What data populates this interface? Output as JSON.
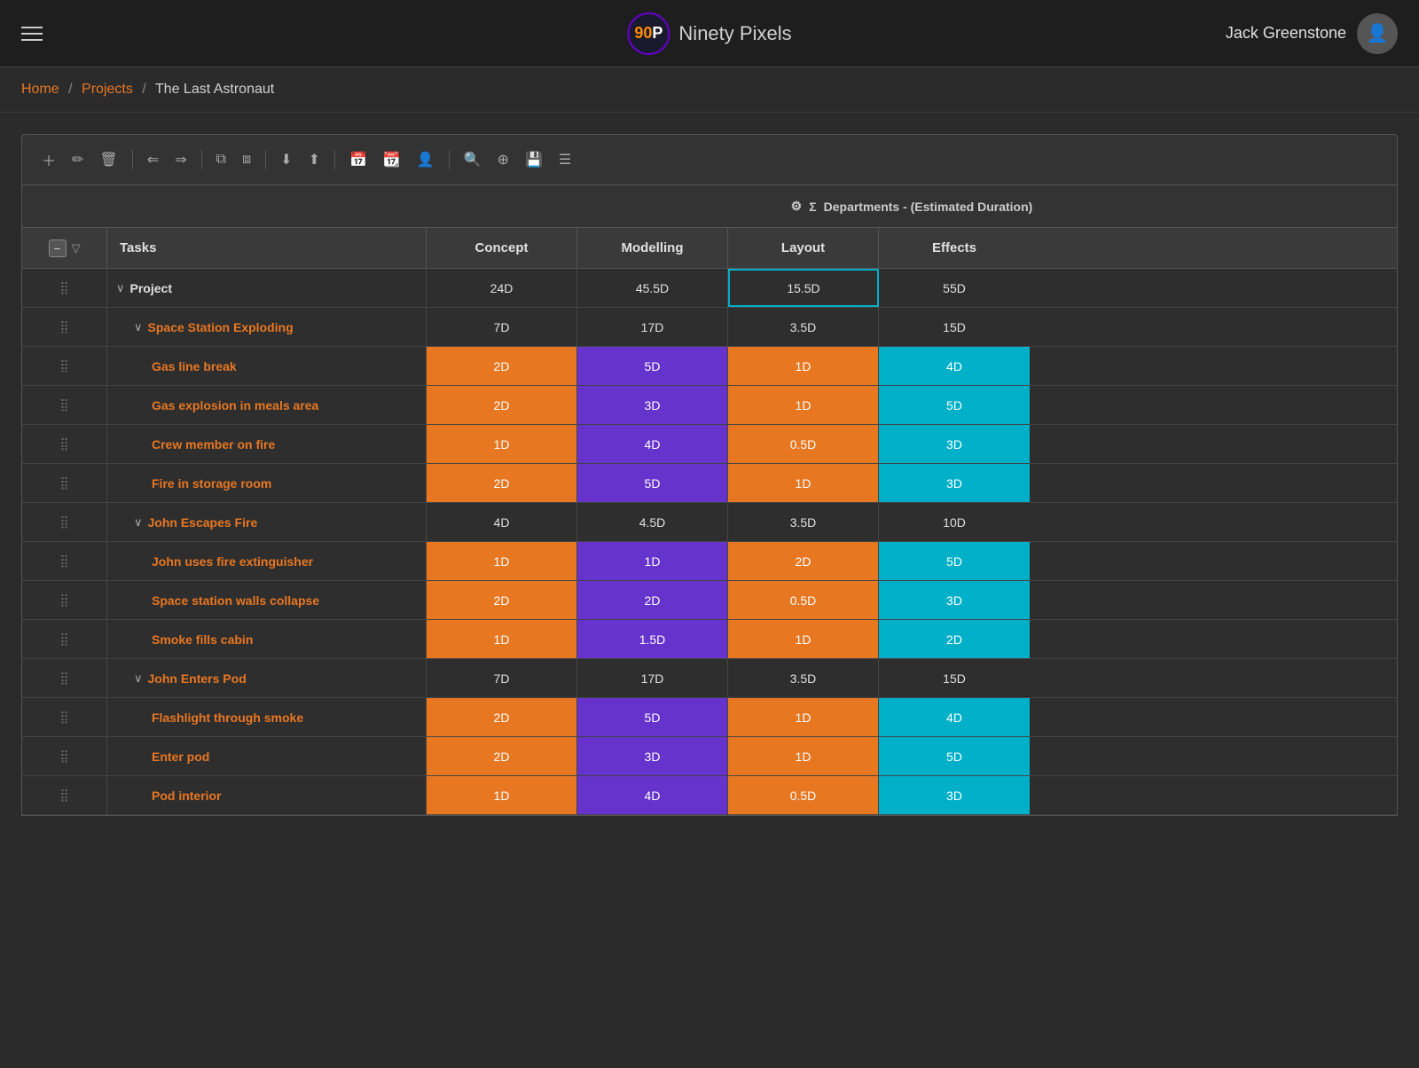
{
  "nav": {
    "hamburger_label": "menu",
    "logo_text": "90P",
    "logo_number": "90",
    "logo_letter": "P",
    "brand_name": "Ninety Pixels",
    "user_name": "Jack Greenstone"
  },
  "breadcrumb": {
    "home": "Home",
    "projects": "Projects",
    "current": "The Last Astronaut"
  },
  "toolbar": {
    "buttons": [
      "＋",
      "✎",
      "⊟",
      "|",
      "⇐",
      "⇒",
      "|",
      "⧉",
      "⧈",
      "|",
      "↓↑",
      "⇣",
      "⇡",
      "|",
      "📅",
      "📆",
      "👤",
      "|",
      "🔍",
      "⊕",
      "💾",
      "≡"
    ]
  },
  "table": {
    "dept_header": "Departments - (Estimated Duration)",
    "col_tasks": "Tasks",
    "col_concept": "Concept",
    "col_modelling": "Modelling",
    "col_layout": "Layout",
    "col_effects": "Effects",
    "rows": [
      {
        "indent": 1,
        "type": "project",
        "expand": true,
        "label": "Project",
        "concept": "24D",
        "modelling": "45.5D",
        "layout": "15.5D",
        "effects": "55D",
        "concept_bg": "",
        "modelling_bg": "",
        "layout_bg": "highlighted",
        "effects_bg": ""
      },
      {
        "indent": 2,
        "type": "group",
        "expand": true,
        "label": "Space Station Exploding",
        "concept": "7D",
        "modelling": "17D",
        "layout": "3.5D",
        "effects": "15D",
        "concept_bg": "",
        "modelling_bg": "",
        "layout_bg": "",
        "effects_bg": ""
      },
      {
        "indent": 3,
        "type": "task",
        "label": "Gas line break",
        "concept": "2D",
        "modelling": "5D",
        "layout": "1D",
        "effects": "4D",
        "concept_bg": "orange",
        "modelling_bg": "purple",
        "layout_bg": "orange",
        "effects_bg": "cyan"
      },
      {
        "indent": 3,
        "type": "task",
        "label": "Gas explosion in meals area",
        "concept": "2D",
        "modelling": "3D",
        "layout": "1D",
        "effects": "5D",
        "concept_bg": "orange",
        "modelling_bg": "purple",
        "layout_bg": "orange",
        "effects_bg": "cyan"
      },
      {
        "indent": 3,
        "type": "task",
        "label": "Crew member on fire",
        "concept": "1D",
        "modelling": "4D",
        "layout": "0.5D",
        "effects": "3D",
        "concept_bg": "orange",
        "modelling_bg": "purple",
        "layout_bg": "orange",
        "effects_bg": "cyan"
      },
      {
        "indent": 3,
        "type": "task",
        "label": "Fire in storage room",
        "concept": "2D",
        "modelling": "5D",
        "layout": "1D",
        "effects": "3D",
        "concept_bg": "orange",
        "modelling_bg": "purple",
        "layout_bg": "orange",
        "effects_bg": "cyan"
      },
      {
        "indent": 2,
        "type": "group",
        "expand": true,
        "label": "John Escapes Fire",
        "concept": "4D",
        "modelling": "4.5D",
        "layout": "3.5D",
        "effects": "10D",
        "concept_bg": "",
        "modelling_bg": "",
        "layout_bg": "",
        "effects_bg": ""
      },
      {
        "indent": 3,
        "type": "task",
        "label": "John uses fire extinguisher",
        "concept": "1D",
        "modelling": "1D",
        "layout": "2D",
        "effects": "5D",
        "concept_bg": "orange",
        "modelling_bg": "purple",
        "layout_bg": "orange",
        "effects_bg": "cyan"
      },
      {
        "indent": 3,
        "type": "task",
        "label": "Space station walls collapse",
        "concept": "2D",
        "modelling": "2D",
        "layout": "0.5D",
        "effects": "3D",
        "concept_bg": "orange",
        "modelling_bg": "purple",
        "layout_bg": "orange",
        "effects_bg": "cyan"
      },
      {
        "indent": 3,
        "type": "task",
        "label": "Smoke fills cabin",
        "concept": "1D",
        "modelling": "1.5D",
        "layout": "1D",
        "effects": "2D",
        "concept_bg": "orange",
        "modelling_bg": "purple",
        "layout_bg": "orange",
        "effects_bg": "cyan"
      },
      {
        "indent": 2,
        "type": "group",
        "expand": true,
        "label": "John Enters Pod",
        "concept": "7D",
        "modelling": "17D",
        "layout": "3.5D",
        "effects": "15D",
        "concept_bg": "",
        "modelling_bg": "",
        "layout_bg": "",
        "effects_bg": ""
      },
      {
        "indent": 3,
        "type": "task",
        "label": "Flashlight through smoke",
        "concept": "2D",
        "modelling": "5D",
        "layout": "1D",
        "effects": "4D",
        "concept_bg": "orange",
        "modelling_bg": "purple",
        "layout_bg": "orange",
        "effects_bg": "cyan",
        "effects_dots": true
      },
      {
        "indent": 3,
        "type": "task",
        "label": "Enter pod",
        "concept": "2D",
        "modelling": "3D",
        "layout": "1D",
        "effects": "5D",
        "concept_bg": "orange",
        "modelling_bg": "purple",
        "layout_bg": "orange",
        "effects_bg": "cyan"
      },
      {
        "indent": 3,
        "type": "task",
        "label": "Pod interior",
        "concept": "1D",
        "modelling": "4D",
        "layout": "0.5D",
        "effects": "3D",
        "concept_bg": "orange",
        "modelling_bg": "purple",
        "layout_bg": "orange",
        "effects_bg": "cyan",
        "partial": true
      }
    ]
  }
}
